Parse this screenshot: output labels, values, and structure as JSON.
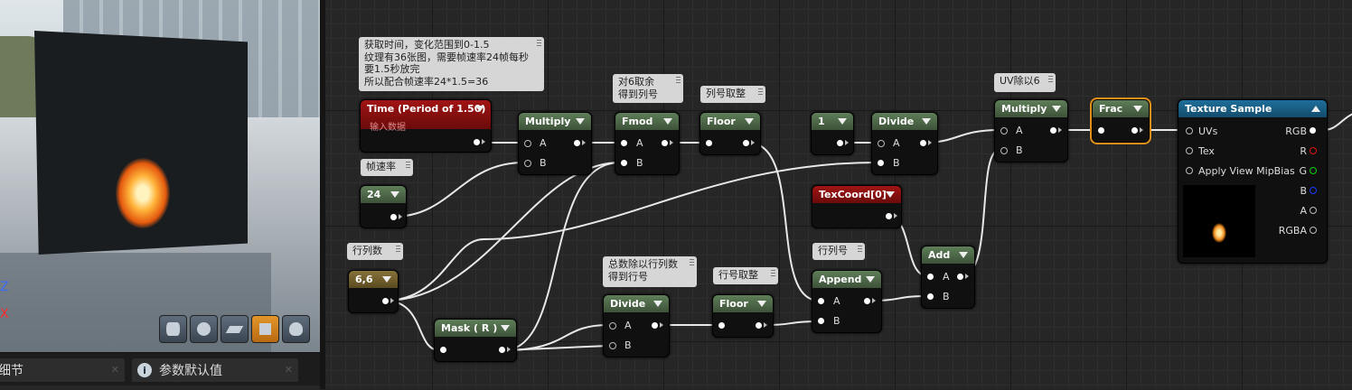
{
  "preview": {
    "axis_z": "Z",
    "axis_x": "X",
    "tools": [
      {
        "icon": "cylinder-icon"
      },
      {
        "icon": "sphere-icon"
      },
      {
        "icon": "plane-icon"
      },
      {
        "icon": "cube-icon",
        "active": true
      },
      {
        "icon": "teapot-icon"
      }
    ]
  },
  "tabs": [
    {
      "label": "细节"
    },
    {
      "label": "参数默认值",
      "icon": "info-icon"
    }
  ],
  "comments": {
    "time": "获取时间，变化范围到0-1.5\n纹理有36张图，需要帧速率24帧每秒\n要1.5秒放完\n所以配合帧速率24*1.5=36",
    "mod6": "对6取余\n得到列号",
    "colfloor": "列号取整",
    "fps": "帧速率",
    "rowcol": "行列数",
    "rowdiv": "总数除以行列数\n得到行号",
    "rowfloor": "行号取整",
    "rowcolnum": "行列号",
    "uvdiv": "UV除以6"
  },
  "nodes": {
    "time": {
      "title": "Time (Period of 1.50)",
      "subtitle": "输入数据"
    },
    "multiply1": {
      "title": "Multiply",
      "a": "A",
      "b": "B"
    },
    "fmod": {
      "title": "Fmod",
      "a": "A",
      "b": "B"
    },
    "floor1": {
      "title": "Floor"
    },
    "const24": {
      "title": "24"
    },
    "const1": {
      "title": "1"
    },
    "divide1": {
      "title": "Divide",
      "a": "A",
      "b": "B"
    },
    "multiply2": {
      "title": "Multiply",
      "a": "A",
      "b": "B"
    },
    "frac": {
      "title": "Frac"
    },
    "texcoord": {
      "title": "TexCoord[0]"
    },
    "const66": {
      "title": "6,6"
    },
    "mask": {
      "title": "Mask ( R )"
    },
    "divide2": {
      "title": "Divide",
      "a": "A",
      "b": "B"
    },
    "floor2": {
      "title": "Floor"
    },
    "append": {
      "title": "Append",
      "a": "A",
      "b": "B"
    },
    "add": {
      "title": "Add",
      "a": "A",
      "b": "B"
    },
    "texsample": {
      "title": "Texture Sample",
      "inputs": [
        "UVs",
        "Tex",
        "Apply View MipBias"
      ],
      "outputs": [
        "RGB",
        "R",
        "G",
        "B",
        "A",
        "RGBA"
      ]
    }
  },
  "colors": {
    "pin_r": "#e01010",
    "pin_g": "#10d010",
    "pin_b": "#1a3aff",
    "selection": "#e0901a"
  }
}
